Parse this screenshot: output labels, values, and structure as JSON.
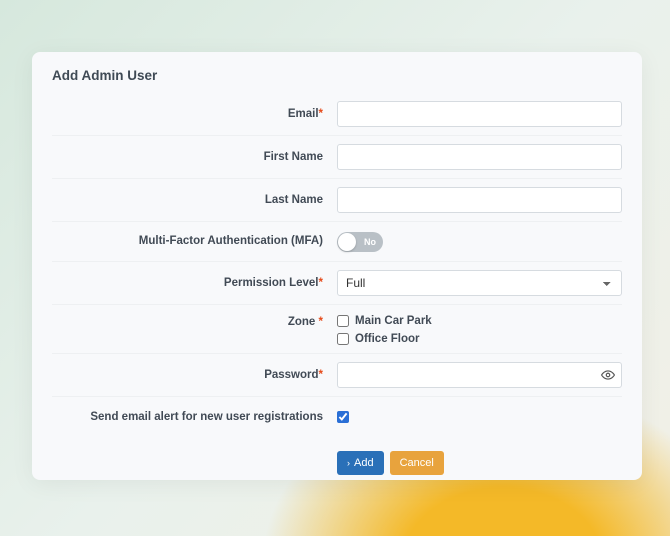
{
  "title": "Add Admin User",
  "fields": {
    "email": {
      "label": "Email",
      "required": true,
      "value": ""
    },
    "firstName": {
      "label": "First Name",
      "required": false,
      "value": ""
    },
    "lastName": {
      "label": "Last Name",
      "required": false,
      "value": ""
    },
    "mfa": {
      "label": "Multi-Factor Authentication (MFA)",
      "state_label": "No",
      "value": false
    },
    "permission": {
      "label": "Permission Level",
      "required": true,
      "selected": "Full",
      "options": [
        "Full"
      ]
    },
    "zone": {
      "label": "Zone",
      "required": true,
      "options": [
        {
          "label": "Main Car Park",
          "checked": false
        },
        {
          "label": "Office Floor",
          "checked": false
        }
      ]
    },
    "password": {
      "label": "Password",
      "required": true,
      "value": ""
    },
    "sendAlert": {
      "label": "Send email alert for new user registrations",
      "checked": true
    }
  },
  "actions": {
    "add": "Add",
    "cancel": "Cancel"
  },
  "required_marker": "*"
}
